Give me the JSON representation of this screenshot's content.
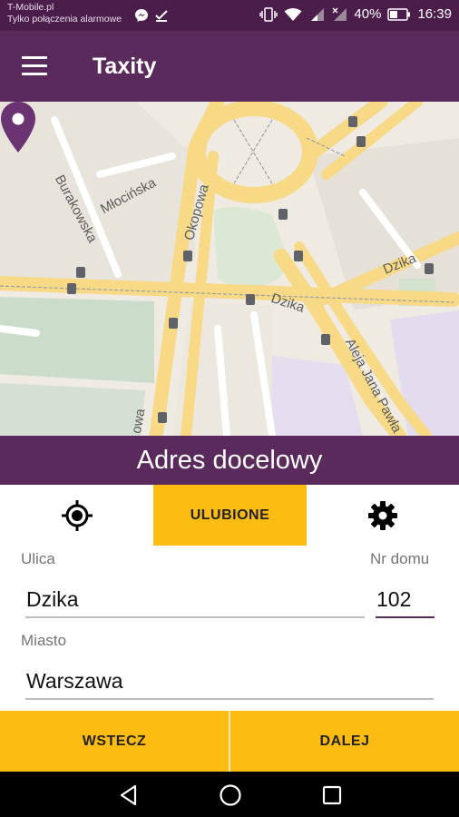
{
  "status_bar": {
    "carrier": "T-Mobile.pl",
    "network_note": "Tylko połączenia alarmowe",
    "battery": "40%",
    "time": "16:39"
  },
  "app_bar": {
    "title": "Taxity",
    "menu_icon": "hamburger-menu-icon"
  },
  "map": {
    "streets": [
      "Burakowska",
      "Młocińska",
      "Okopowa",
      "Dzika",
      "Dzika",
      "Aleja Jana Pawła",
      "owa"
    ],
    "pin_icon": "location-pin-icon",
    "info_icon": "info-icon"
  },
  "destination": {
    "title": "Adres docelowy"
  },
  "tabs": {
    "location_icon": "crosshair-location-icon",
    "favorites_label": "ULUBIONE",
    "settings_icon": "gear-icon"
  },
  "form": {
    "street_label": "Ulica",
    "street_value": "Dzika",
    "house_number_label": "Nr domu",
    "house_number_value": "102",
    "city_label": "Miasto",
    "city_value": "Warszawa"
  },
  "actions": {
    "back_label": "WSTECZ",
    "next_label": "DALEJ"
  },
  "colors": {
    "primary": "#5a2a5c",
    "status_bar": "#4a1d4b",
    "accent": "#fcbc12",
    "road": "#f7d986"
  }
}
